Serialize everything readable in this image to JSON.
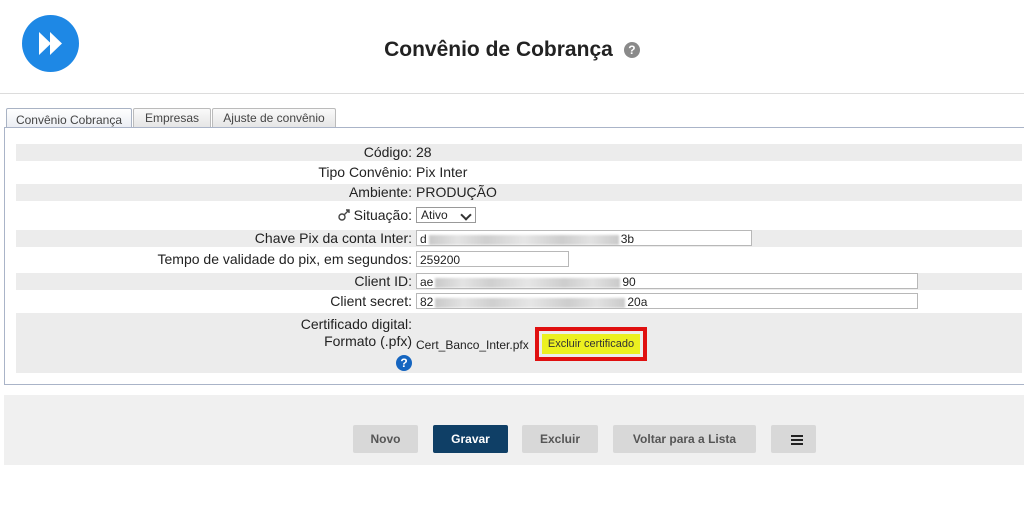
{
  "header": {
    "title": "Convênio de Cobrança",
    "help_icon": "question-circle-icon"
  },
  "tabs": [
    {
      "label": "Convênio Cobrança",
      "active": true
    },
    {
      "label": "Empresas",
      "active": false
    },
    {
      "label": "Ajuste de convênio",
      "active": false
    }
  ],
  "form": {
    "codigo": {
      "label": "Código:",
      "value": "28"
    },
    "tipo": {
      "label": "Tipo Convênio:",
      "value": "Pix Inter"
    },
    "ambiente": {
      "label": "Ambiente:",
      "value": "PRODUÇÃO"
    },
    "situacao": {
      "label": "Situação:",
      "value": "Ativo",
      "icon": "toggle-icon"
    },
    "chave_pix": {
      "label": "Chave Pix da conta Inter:",
      "value_start": "d",
      "value_end": "3b"
    },
    "tempo": {
      "label": "Tempo de validade do pix, em segundos:",
      "value": "259200"
    },
    "client_id": {
      "label": "Client ID:",
      "value_start": "ae",
      "value_end": "90"
    },
    "client_secret": {
      "label": "Client secret:",
      "value_start": "82",
      "value_end": "20a"
    },
    "certificado": {
      "label_line1": "Certificado digital:",
      "label_line2": "Formato (.pfx)",
      "file": "Cert_Banco_Inter.pfx",
      "delete_label": "Excluir certificado"
    }
  },
  "footer": {
    "novo": "Novo",
    "gravar": "Gravar",
    "excluir": "Excluir",
    "voltar": "Voltar para a Lista",
    "list_icon": "list-icon"
  },
  "colors": {
    "primary": "#0f3f66",
    "logo": "#1e88e5",
    "highlight": "#ecf020",
    "highlight_border": "#e01010"
  }
}
